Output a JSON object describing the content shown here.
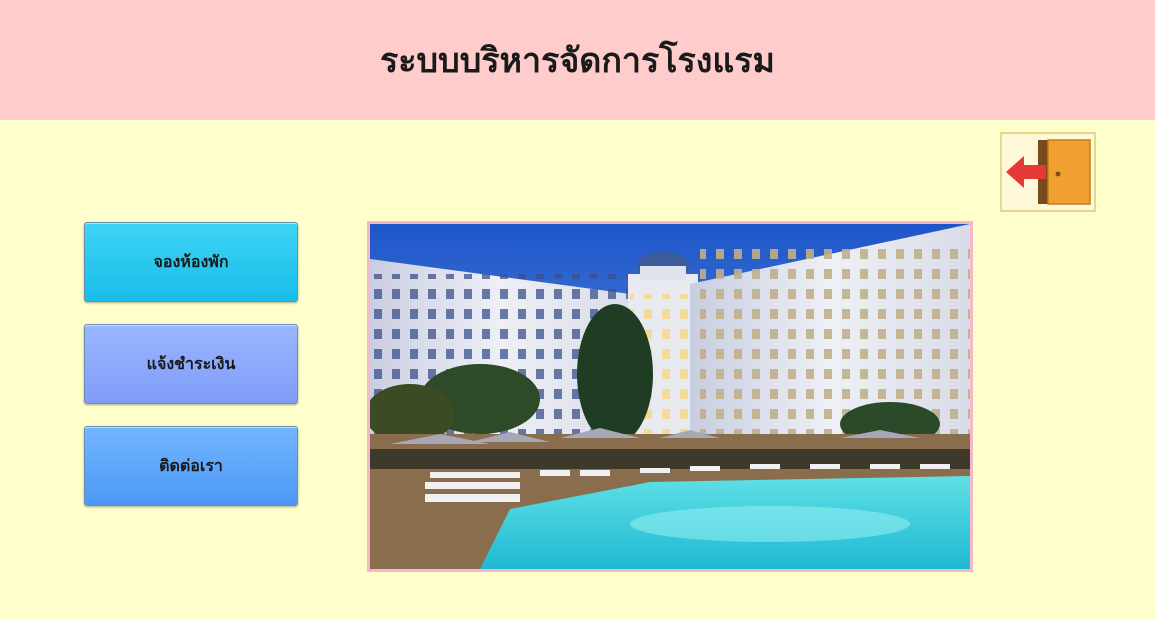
{
  "header": {
    "title": "ระบบบริหารจัดการโรงแรม"
  },
  "exit_button": {
    "icon": "exit-door-icon"
  },
  "menu": {
    "book_room": "จองห้องพัก",
    "payment_notice": "แจ้งชำระเงิน",
    "contact_us": "ติดต่อเรา"
  },
  "photo": {
    "subject": "hotel-pool-photo"
  },
  "colors": {
    "header_bg": "#ffcccc",
    "page_bg": "#ffffcc",
    "book_btn": "#17bde8",
    "pay_btn": "#7f9df7",
    "contact_btn": "#4c98f5",
    "exit_arrow": "#e53935",
    "door": "#f0a030"
  }
}
